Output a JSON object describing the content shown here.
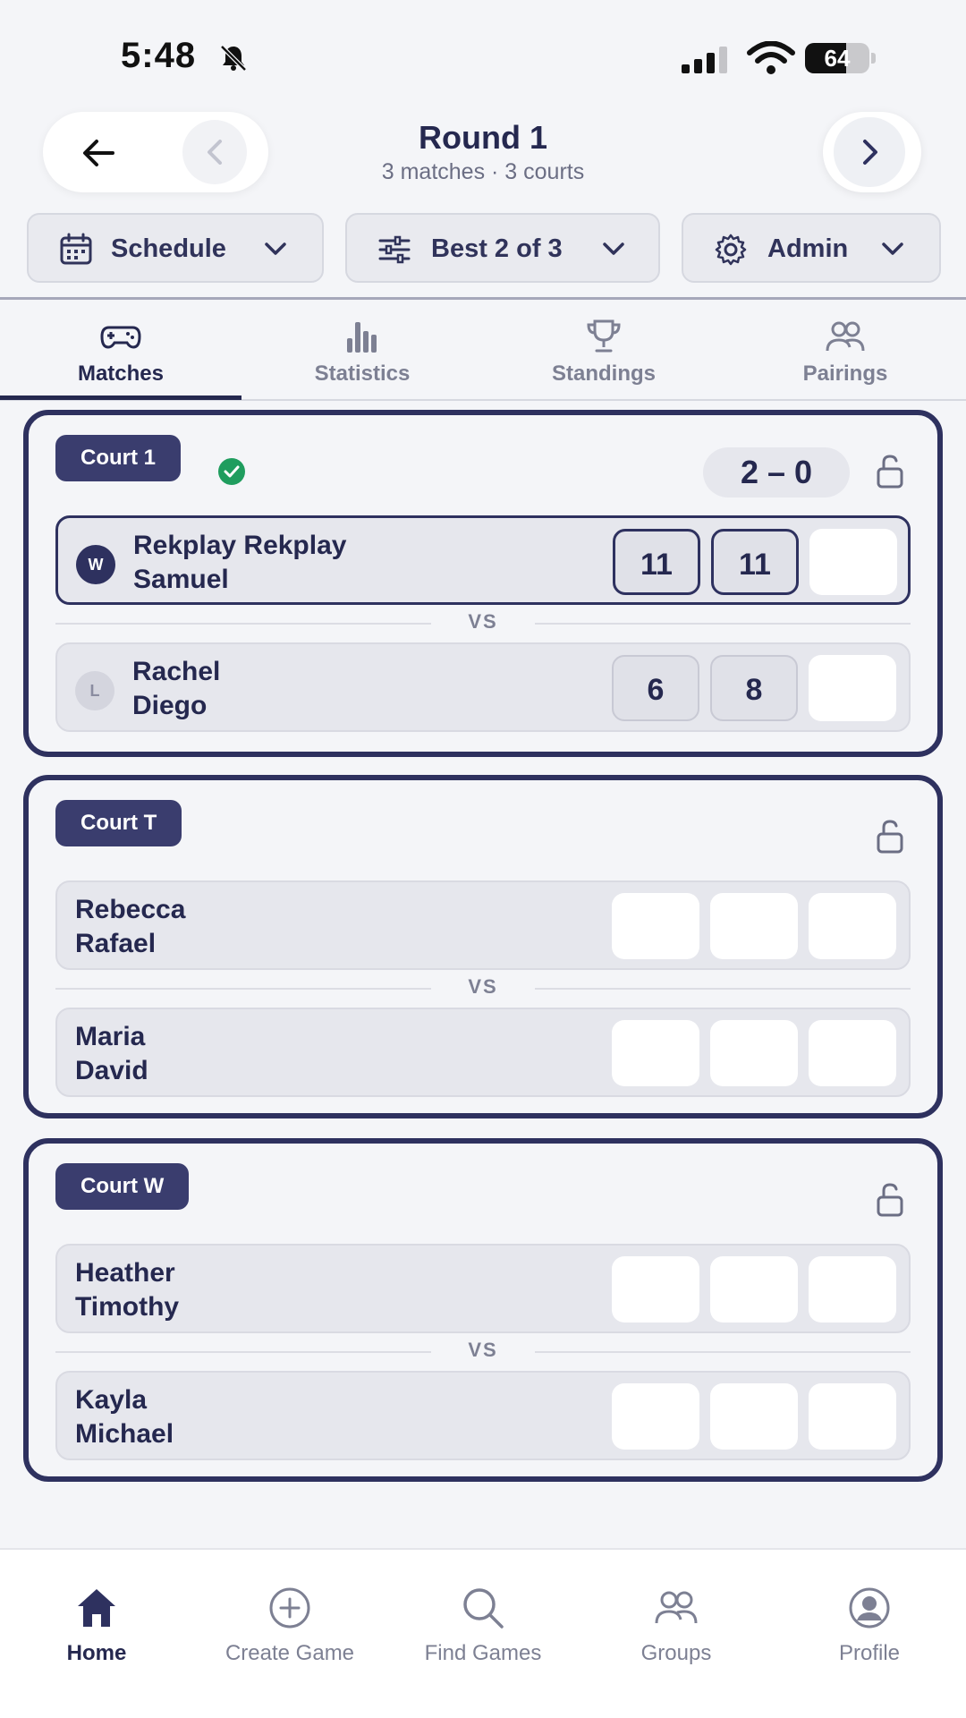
{
  "status_bar": {
    "time": "5:48",
    "battery": "64",
    "battery_level": 0.64
  },
  "header": {
    "title": "Round 1",
    "subtitle": "3 matches  ·  3 courts",
    "back_icon": "back-arrow-icon",
    "prev_icon": "chevron-left-icon",
    "next_icon": "chevron-right-icon"
  },
  "dropdowns": [
    {
      "label": "Schedule",
      "icon": "calendar-icon"
    },
    {
      "label": "Best 2 of 3",
      "icon": "sliders-icon"
    },
    {
      "label": "Admin",
      "icon": "gear-icon"
    }
  ],
  "tabs": [
    {
      "label": "Matches",
      "icon": "gamepad-icon",
      "active": true
    },
    {
      "label": "Statistics",
      "icon": "bar-chart-icon",
      "active": false
    },
    {
      "label": "Standings",
      "icon": "trophy-icon",
      "active": false
    },
    {
      "label": "Pairings",
      "icon": "people-icon",
      "active": false
    }
  ],
  "courts": [
    {
      "name": "Court 1",
      "completed": true,
      "score": "2 – 0",
      "vs": "VS",
      "teams": [
        {
          "result": "W",
          "line1": "Rekplay Rekplay",
          "line2": "Samuel",
          "games": [
            "11",
            "11",
            ""
          ]
        },
        {
          "result": "L",
          "line1": "Rachel",
          "line2": "Diego",
          "games": [
            "6",
            "8",
            ""
          ]
        }
      ]
    },
    {
      "name": "Court T",
      "completed": false,
      "vs": "VS",
      "teams": [
        {
          "line1": "Rebecca",
          "line2": "Rafael",
          "games": [
            "",
            "",
            ""
          ]
        },
        {
          "line1": "Maria",
          "line2": "David",
          "games": [
            "",
            "",
            ""
          ]
        }
      ]
    },
    {
      "name": "Court W",
      "completed": false,
      "vs": "VS",
      "teams": [
        {
          "line1": "Heather",
          "line2": "Timothy",
          "games": [
            "",
            "",
            ""
          ]
        },
        {
          "line1": "Kayla",
          "line2": "Michael",
          "games": [
            "",
            "",
            ""
          ]
        }
      ]
    }
  ],
  "bottom_nav": [
    {
      "label": "Home",
      "icon": "home-icon",
      "active": true
    },
    {
      "label": "Create Game",
      "icon": "plus-circle-icon",
      "active": false
    },
    {
      "label": "Find Games",
      "icon": "search-icon",
      "active": false
    },
    {
      "label": "Groups",
      "icon": "people-icon",
      "active": false
    },
    {
      "label": "Profile",
      "icon": "user-circle-icon",
      "active": false
    }
  ],
  "colors": {
    "primary": "#2e315f",
    "background": "#f4f5f8",
    "success": "#1f9d5e",
    "muted": "#7d8093"
  }
}
